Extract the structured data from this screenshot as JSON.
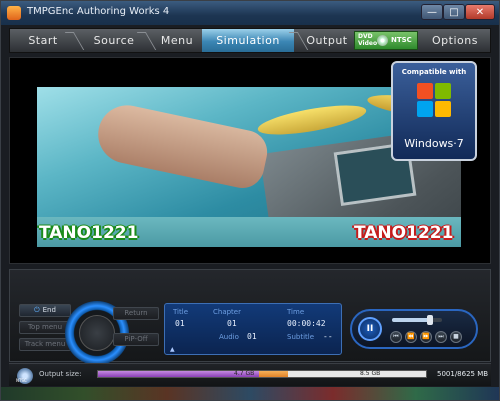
{
  "window": {
    "title": "TMPGEnc Authoring Works 4"
  },
  "nav": {
    "tabs": [
      {
        "label": "Start"
      },
      {
        "label": "Source"
      },
      {
        "label": "Menu"
      },
      {
        "label": "Simulation"
      },
      {
        "label": "Output"
      },
      {
        "label": "Options"
      }
    ],
    "active_tab": "Simulation",
    "badge": {
      "dvd": "DVD\nVideo",
      "format": "NTSC"
    }
  },
  "overlay": {
    "compat": "Compatible with",
    "brand": "Windows·7",
    "watermark_left": "TANO1221",
    "watermark_right": "TANO1221"
  },
  "controls": {
    "end_label": "End",
    "top_menu": "Top menu",
    "track_menu": "Track menu",
    "return_label": "Return",
    "pip_off": "PiP-Off",
    "lcd": {
      "title_label": "Title",
      "title_value": "01",
      "chapter_label": "Chapter",
      "chapter_value": "01",
      "time_label": "Time",
      "time_value": "00:00:42",
      "audio_label": "Audio",
      "audio_value": "01",
      "subtitle_label": "Subtitle",
      "subtitle_value": "--"
    },
    "volume": 0.75
  },
  "status": {
    "label": "Output size:",
    "mark_47": "4.7 GB",
    "mark_85": "8.5 GB",
    "used_fraction": 0.49,
    "limit_fraction": 0.58,
    "readout": "5001/8625 MB",
    "ntsc": "NTSC"
  },
  "colors": {
    "accent": "#3b86b4",
    "lcd": "#123a78",
    "watermark_green": "#1a8a1a",
    "watermark_red": "#c41c1c"
  }
}
